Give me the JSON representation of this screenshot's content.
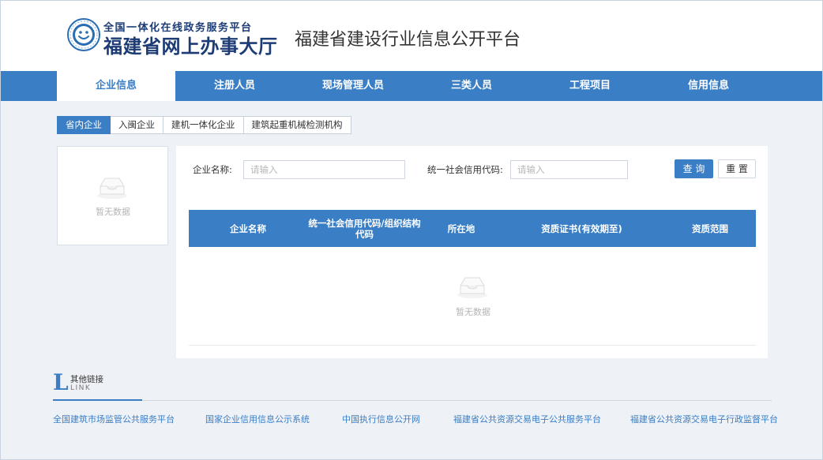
{
  "header": {
    "gov_line1": "全国一体化在线政务服务平台",
    "gov_line2": "福建省网上办事大厅",
    "platform_title": "福建省建设行业信息公开平台",
    "logo_icon": "smiley-emblem-icon"
  },
  "nav": {
    "items": [
      {
        "label": "企业信息",
        "active": true
      },
      {
        "label": "注册人员",
        "active": false
      },
      {
        "label": "现场管理人员",
        "active": false
      },
      {
        "label": "三类人员",
        "active": false
      },
      {
        "label": "工程项目",
        "active": false
      },
      {
        "label": "信用信息",
        "active": false
      }
    ]
  },
  "subtabs": [
    {
      "label": "省内企业",
      "active": true
    },
    {
      "label": "入闽企业",
      "active": false
    },
    {
      "label": "建机一体化企业",
      "active": false
    },
    {
      "label": "建筑起重机械检测机构",
      "active": false
    }
  ],
  "left_panel": {
    "empty_text": "暂无数据",
    "icon": "empty-inbox-icon"
  },
  "search": {
    "name_label": "企业名称:",
    "name_placeholder": "请输入",
    "code_label": "统一社会信用代码:",
    "code_placeholder": "请输入",
    "query_button": "查 询",
    "reset_button": "重 置"
  },
  "table": {
    "columns": [
      "企业名称",
      "统一社会信用代码/组织结构代码",
      "所在地",
      "资质证书(有效期至)",
      "资质范围"
    ],
    "rows": [],
    "empty_text": "暂无数据"
  },
  "links": {
    "letter": "L",
    "title": "其他链接",
    "subtitle": "LINK",
    "items": [
      "全国建筑市场监管公共服务平台",
      "国家企业信用信息公示系统",
      "中国执行信息公开网",
      "福建省公共资源交易电子公共服务平台",
      "福建省公共资源交易电子行政监督平台"
    ]
  },
  "colors": {
    "primary": "#3a7ec5",
    "page_bg": "#eef1f6",
    "brand_text": "#1d3b74"
  }
}
